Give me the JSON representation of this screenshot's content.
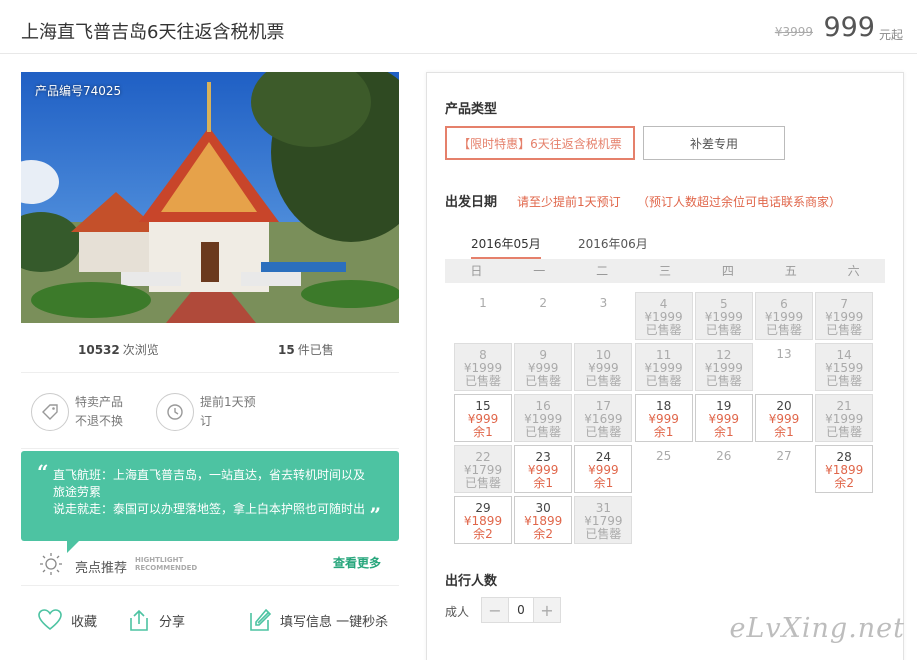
{
  "header": {
    "title": "上海直飞普吉岛6天往返含税机票",
    "old_price": "¥3999",
    "price": "999",
    "price_unit": "元起"
  },
  "photo": {
    "product_no": "产品编号74025"
  },
  "stats": {
    "views_num": "10532",
    "views_label": "次浏览",
    "sold_num": "15",
    "sold_label": "件已售"
  },
  "features": [
    {
      "icon": "price-tag-icon",
      "line1": "特卖产品",
      "line2": "不退不换"
    },
    {
      "icon": "clock-icon",
      "line1": "提前1天预",
      "line2": "订"
    }
  ],
  "quote": {
    "open": "“",
    "line1": "直飞航班：上海直飞普吉岛，一站直达，省去转机时间以及",
    "line2": "旅途劳累",
    "line3": "说走就走：泰国可以办理落地签，拿上白本护照也可随时出",
    "close": "”"
  },
  "highlight": {
    "title": "亮点推荐",
    "en1": "HIGHTLIGHT",
    "en2": "RECOMMENDED",
    "more": "查看更多"
  },
  "actions": {
    "favorite": "收藏",
    "share": "分享",
    "fill_info": "填写信息 一键秒杀"
  },
  "booking": {
    "type_label": "产品类型",
    "types": [
      "【限时特惠】6天往返含税机票",
      "补差专用"
    ],
    "date_label": "出发日期",
    "date_tip1": "请至少提前1天预订",
    "date_tip2": "（预订人数超过余位可电话联系商家）",
    "months": [
      "2016年05月",
      "2016年06月"
    ],
    "weekdays": [
      "日",
      "一",
      "二",
      "三",
      "四",
      "五",
      "六"
    ],
    "pax_section": "出行人数",
    "pax_label": "成人",
    "minus": "−",
    "plus": "+",
    "pax_value": "0"
  },
  "calendar": [
    [
      {
        "d": "1",
        "t": "plain"
      },
      {
        "d": "2",
        "t": "plain"
      },
      {
        "d": "3",
        "t": "plain"
      },
      {
        "d": "4",
        "t": "sold",
        "p": "¥1999",
        "s": "已售罄"
      },
      {
        "d": "5",
        "t": "sold",
        "p": "¥1999",
        "s": "已售罄"
      },
      {
        "d": "6",
        "t": "sold",
        "p": "¥1999",
        "s": "已售罄"
      },
      {
        "d": "7",
        "t": "sold",
        "p": "¥1999",
        "s": "已售罄"
      }
    ],
    [
      {
        "d": "8",
        "t": "sold",
        "p": "¥1999",
        "s": "已售罄"
      },
      {
        "d": "9",
        "t": "sold",
        "p": "¥999",
        "s": "已售罄"
      },
      {
        "d": "10",
        "t": "sold",
        "p": "¥999",
        "s": "已售罄"
      },
      {
        "d": "11",
        "t": "sold",
        "p": "¥1999",
        "s": "已售罄"
      },
      {
        "d": "12",
        "t": "sold",
        "p": "¥1999",
        "s": "已售罄"
      },
      {
        "d": "13",
        "t": "plain"
      },
      {
        "d": "14",
        "t": "sold",
        "p": "¥1599",
        "s": "已售罄"
      }
    ],
    [
      {
        "d": "15",
        "t": "avail",
        "p": "¥999",
        "s": "余1"
      },
      {
        "d": "16",
        "t": "sold",
        "p": "¥1999",
        "s": "已售罄"
      },
      {
        "d": "17",
        "t": "sold",
        "p": "¥1699",
        "s": "已售罄"
      },
      {
        "d": "18",
        "t": "avail",
        "p": "¥999",
        "s": "余1"
      },
      {
        "d": "19",
        "t": "avail",
        "p": "¥999",
        "s": "余1"
      },
      {
        "d": "20",
        "t": "avail",
        "p": "¥999",
        "s": "余1"
      },
      {
        "d": "21",
        "t": "sold",
        "p": "¥1999",
        "s": "已售罄"
      }
    ],
    [
      {
        "d": "22",
        "t": "sold",
        "p": "¥1799",
        "s": "已售罄"
      },
      {
        "d": "23",
        "t": "avail",
        "p": "¥999",
        "s": "余1"
      },
      {
        "d": "24",
        "t": "avail",
        "p": "¥999",
        "s": "余1"
      },
      {
        "d": "25",
        "t": "plain"
      },
      {
        "d": "26",
        "t": "plain"
      },
      {
        "d": "27",
        "t": "plain"
      },
      {
        "d": "28",
        "t": "avail",
        "p": "¥1899",
        "s": "余2"
      }
    ],
    [
      {
        "d": "29",
        "t": "avail",
        "p": "¥1899",
        "s": "余2"
      },
      {
        "d": "30",
        "t": "avail",
        "p": "¥1899",
        "s": "余2"
      },
      {
        "d": "31",
        "t": "sold",
        "p": "¥1799",
        "s": "已售罄"
      }
    ]
  ],
  "watermark": "eLvXing.net",
  "colors": {
    "accent": "#e5806b",
    "teal": "#4dc3a2",
    "price_red": "#e0664a",
    "link_green": "#27a67c"
  }
}
